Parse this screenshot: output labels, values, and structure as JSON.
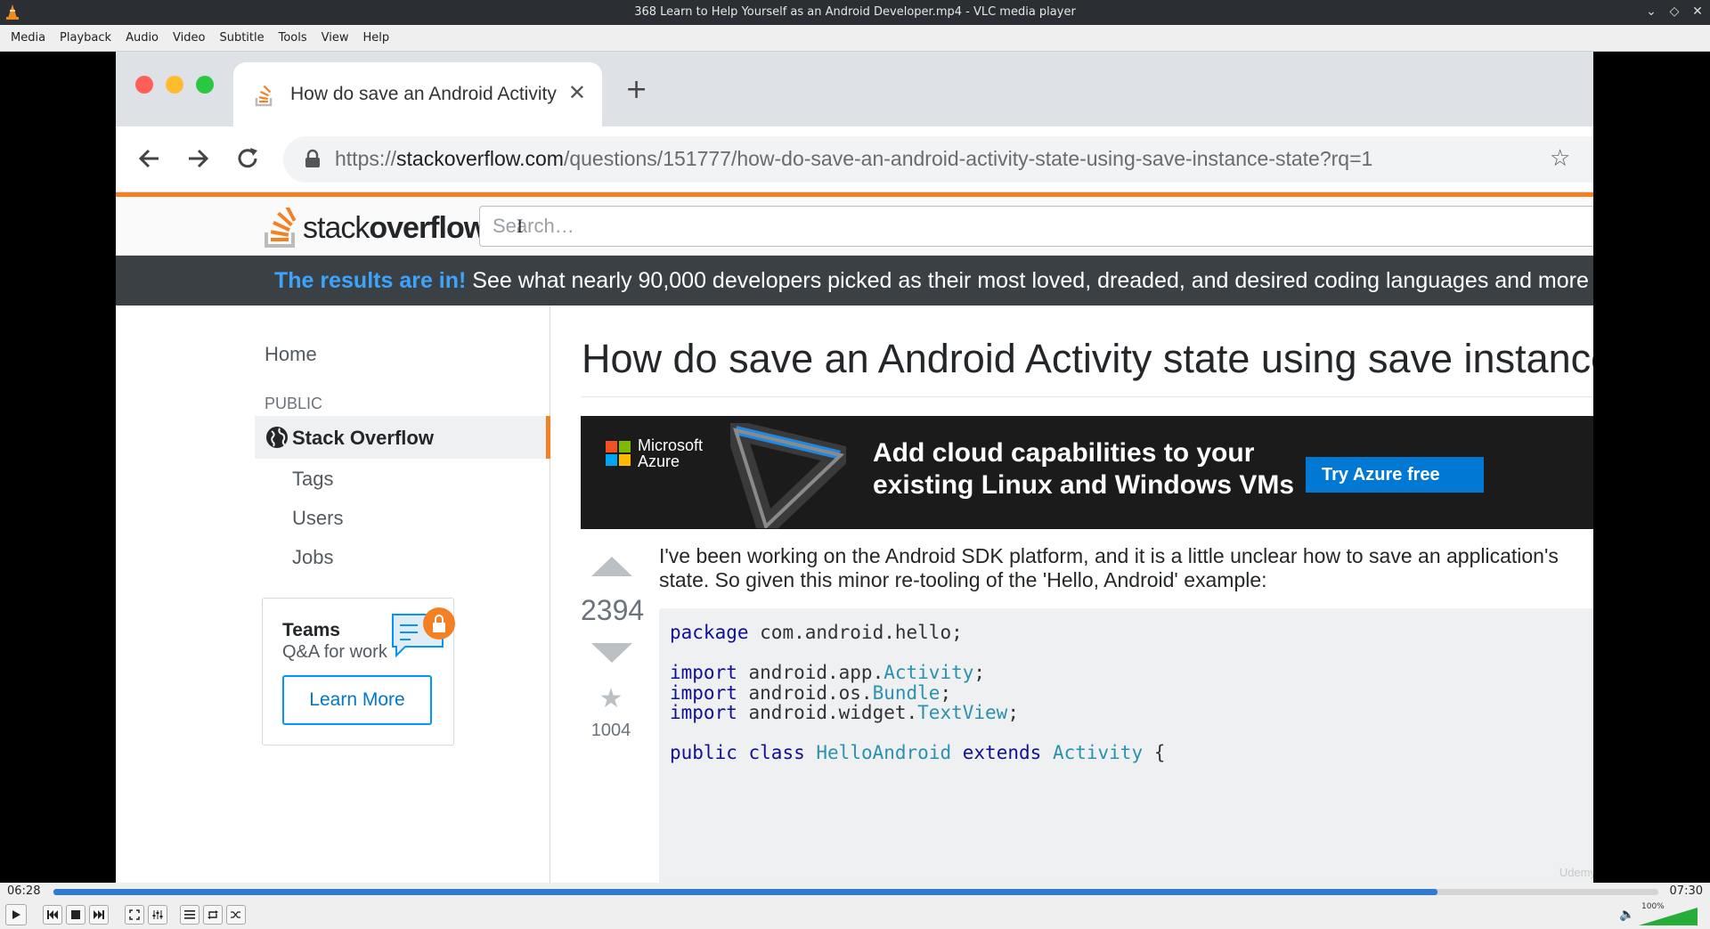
{
  "window": {
    "title": "368 Learn to Help Yourself as an Android Developer.mp4 - VLC media player"
  },
  "menu": [
    "Media",
    "Playback",
    "Audio",
    "Video",
    "Subtitle",
    "Tools",
    "View",
    "Help"
  ],
  "browser": {
    "tab_title": "How do save an Android Activity state using save instance state",
    "url_scheme": "https://",
    "url_host": "stackoverflow.com",
    "url_path": "/questions/151777/how-do-save-an-android-activity-state-using-save-instance-state?rq=1"
  },
  "so": {
    "logo_plain": "stack",
    "logo_bold": "overflow",
    "search_placeholder": "Search…",
    "banner_highlight": "The results are in!",
    "banner_text": " See what nearly 90,000 developers picked as their most loved, dreaded, and desired coding languages and more",
    "nav": {
      "home": "Home",
      "public": "PUBLIC",
      "stack_overflow": "Stack Overflow",
      "tags": "Tags",
      "users": "Users",
      "jobs": "Jobs"
    },
    "teams": {
      "title": "Teams",
      "subtitle": "Q&A for work",
      "button": "Learn More"
    },
    "question": {
      "title": "How do save an Android Activity state using save instance state?",
      "votes": "2394",
      "favorites": "1004",
      "body_line1": "I've been working on the Android SDK platform, and it is a little unclear how to save an application's",
      "body_line2": "state. So given this minor re-tooling of the 'Hello, Android' example:"
    },
    "ad": {
      "brand_line1": "Microsoft",
      "brand_line2": "Azure",
      "headline_line1": "Add cloud capabilities to your",
      "headline_line2": "existing Linux and Windows VMs",
      "button": "Try Azure free"
    },
    "code": {
      "l1_kw": "package",
      "l1_rest": " com.android.hello;",
      "l3_kw": "import",
      "l3_a": " android.app.",
      "l3_t": "Activity",
      "l3_b": ";",
      "l4_kw": "import",
      "l4_a": " android.os.",
      "l4_t": "Bundle",
      "l4_b": ";",
      "l5_kw": "import",
      "l5_a": " android.widget.",
      "l5_t": "TextView",
      "l5_b": ";",
      "l7_kw1": "public",
      "l7_kw2": "class",
      "l7_t1": "HelloAndroid",
      "l7_kw3": "extends",
      "l7_t2": "Activity",
      "l7_end": " {"
    },
    "watermark": "Udemy"
  },
  "player": {
    "time_current": "06:28",
    "time_total": "07:30",
    "progress_fraction": 0.8622,
    "volume_label": "100%",
    "volume_fraction": 1.0
  }
}
